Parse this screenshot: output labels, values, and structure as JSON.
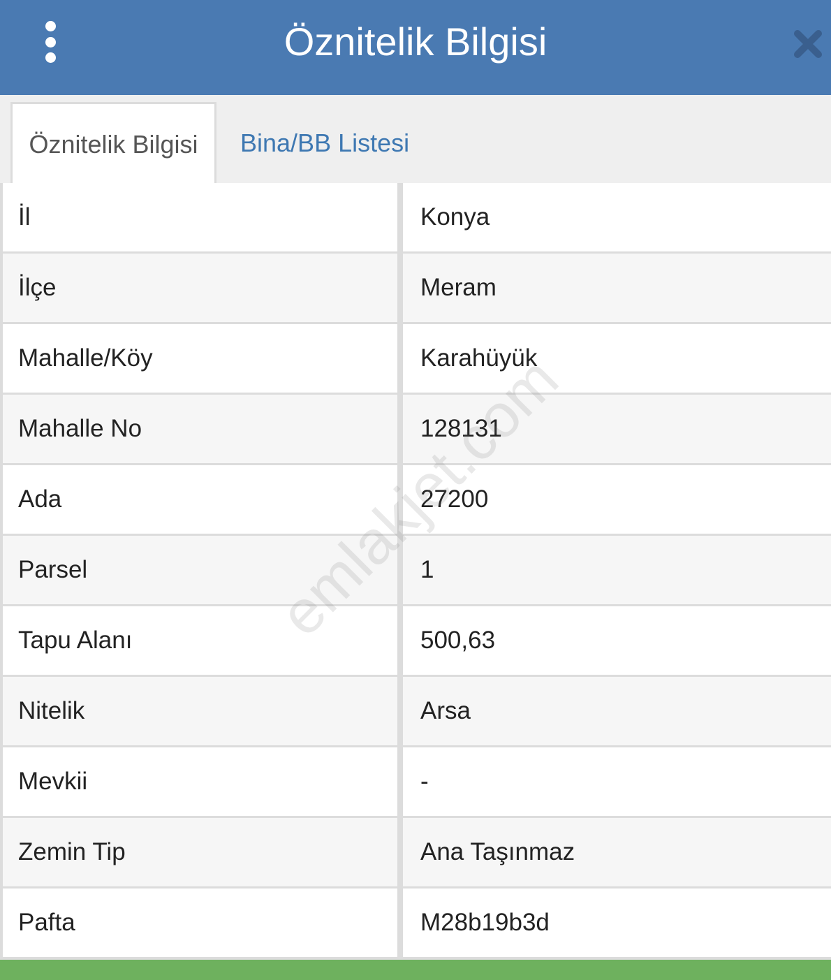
{
  "header": {
    "title": "Öznitelik Bilgisi",
    "menu_icon": "kebab-menu-icon",
    "close_icon": "close-icon",
    "color": "#4a7ab2"
  },
  "tabs": [
    {
      "label": "Öznitelik Bilgisi",
      "active": true
    },
    {
      "label": "Bina/BB Listesi",
      "active": false
    }
  ],
  "rows": [
    {
      "label": "İl",
      "value": "Konya"
    },
    {
      "label": "İlçe",
      "value": "Meram"
    },
    {
      "label": "Mahalle/Köy",
      "value": "Karahüyük"
    },
    {
      "label": "Mahalle No",
      "value": "128131"
    },
    {
      "label": "Ada",
      "value": "27200"
    },
    {
      "label": "Parsel",
      "value": "1"
    },
    {
      "label": "Tapu Alanı",
      "value": "500,63"
    },
    {
      "label": "Nitelik",
      "value": "Arsa"
    },
    {
      "label": "Mevkii",
      "value": "-"
    },
    {
      "label": "Zemin Tip",
      "value": "Ana Taşınmaz"
    },
    {
      "label": "Pafta",
      "value": "M28b19b3d"
    }
  ],
  "watermark": "emlakjet.com",
  "colors": {
    "accent_bar": "#6eb15e",
    "tab_link": "#3e78b2"
  }
}
